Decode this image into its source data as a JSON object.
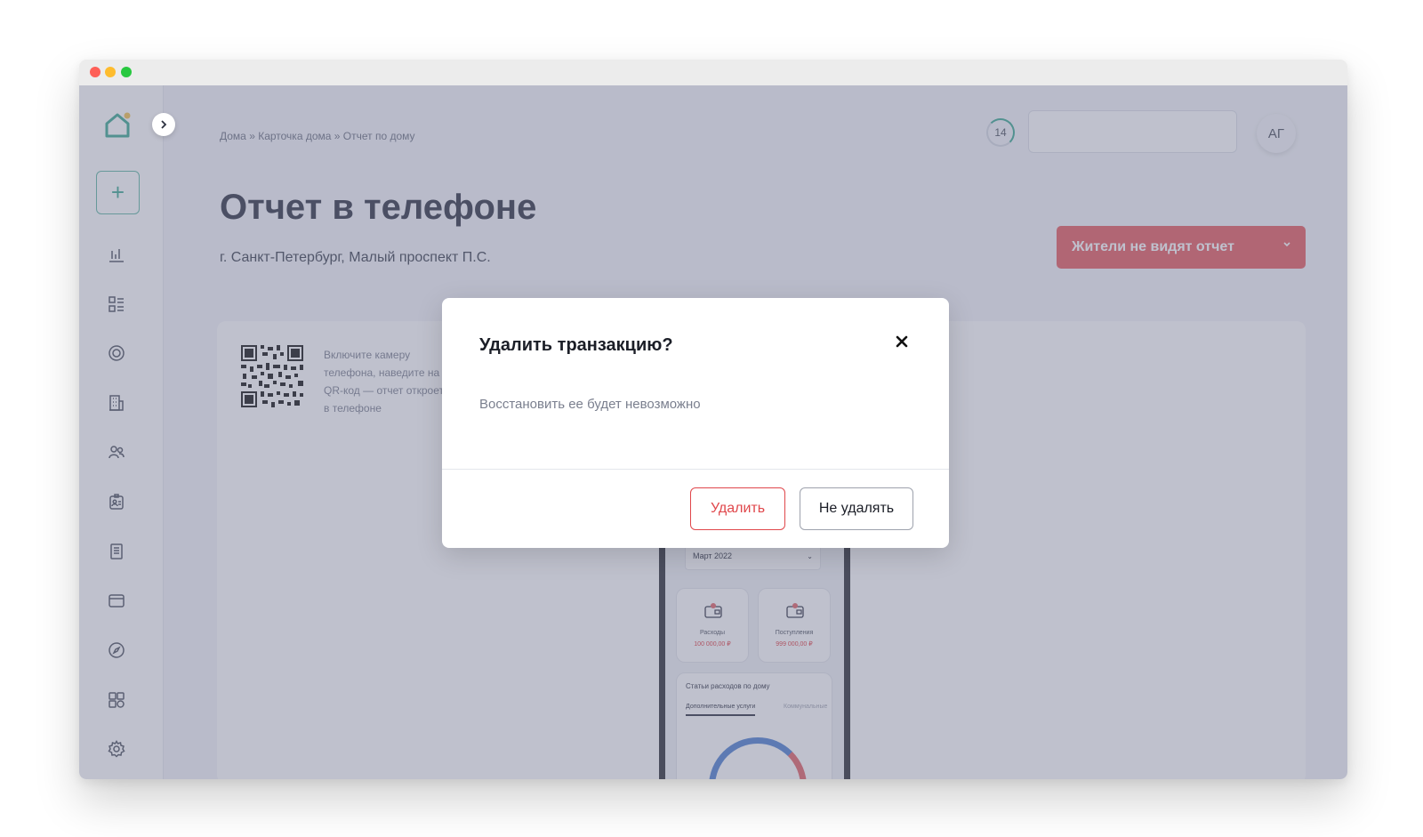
{
  "breadcrumb": "Дома » Карточка дома » Отчет по дому",
  "header": {
    "notification_count": "14",
    "avatar_initials": "АГ"
  },
  "page": {
    "title": "Отчет в телефоне",
    "subtitle": "г. Санкт-Петербург, Малый проспект П.С."
  },
  "visibility_dropdown": {
    "label": "Жители не видят отчет"
  },
  "qr_card": {
    "text": "Включите камеру телефона, наведите на QR-код — отчет откроется в телефоне"
  },
  "phone": {
    "month": "Март 2022",
    "expenses_label": "Расходы",
    "expenses_value": "100 000,00 ₽",
    "income_label": "Поступления",
    "income_value": "999 000,00 ₽",
    "stats_title": "Статьи расходов по дому",
    "tab_additional": "Дополнительные услуги",
    "tab_utilities": "Коммунальные"
  },
  "modal": {
    "title": "Удалить транзакцию?",
    "description": "Восстановить ее будет невозможно",
    "delete_label": "Удалить",
    "keep_label": "Не удалять"
  },
  "colors": {
    "accent_green": "#3aa890",
    "danger_red": "#e55a5e",
    "overlay": "#707691"
  },
  "sidebar_icons": [
    "analytics-icon",
    "list-icon",
    "target-icon",
    "building-icon",
    "users-icon",
    "badge-icon",
    "document-icon",
    "wallet-icon",
    "compass-icon",
    "grid-icon",
    "gear-icon"
  ]
}
